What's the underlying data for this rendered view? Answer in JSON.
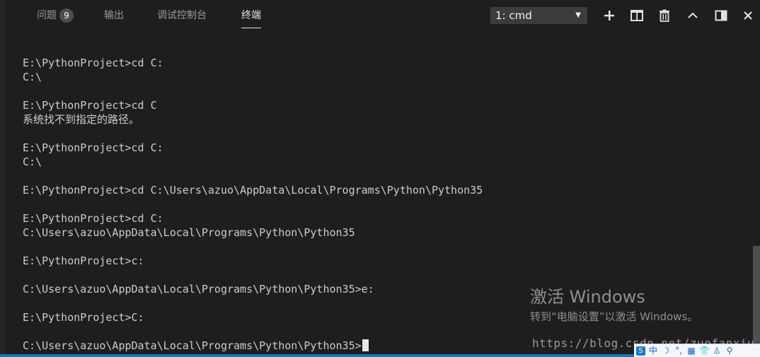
{
  "panel": {
    "tabs": [
      {
        "label": "问题",
        "badge": "9"
      },
      {
        "label": "输出"
      },
      {
        "label": "调试控制台"
      },
      {
        "label": "终端"
      }
    ],
    "terminal_selector": {
      "value": "1: cmd"
    },
    "icons": [
      "plus-icon",
      "split-icon",
      "trash-icon",
      "chevron-up-icon",
      "maximize-icon",
      "close-icon"
    ]
  },
  "terminal": {
    "lines": [
      "E:\\PythonProject>cd C:",
      "C:\\",
      "",
      "E:\\PythonProject>cd C",
      "系统找不到指定的路径。",
      "",
      "E:\\PythonProject>cd C:",
      "C:\\",
      "",
      "E:\\PythonProject>cd C:\\Users\\azuo\\AppData\\Local\\Programs\\Python\\Python35",
      "",
      "E:\\PythonProject>cd C:",
      "C:\\Users\\azuo\\AppData\\Local\\Programs\\Python\\Python35",
      "",
      "E:\\PythonProject>c:",
      "",
      "C:\\Users\\azuo\\AppData\\Local\\Programs\\Python\\Python35>e:",
      "",
      "E:\\PythonProject>C:",
      "",
      "C:\\Users\\azuo\\AppData\\Local\\Programs\\Python\\Python35>"
    ]
  },
  "watermark": {
    "activate_title": "激活 Windows",
    "activate_subtitle": "转到“电脑设置”以激活 Windows。",
    "blog_url": "https://blog.csdn.net/zuofanxiu"
  },
  "ime": {
    "logo": "S",
    "items": [
      "中",
      "☽",
      "°,",
      "▦",
      "👕",
      "♙",
      "⚲"
    ]
  },
  "colors": {
    "background": "#1e1e1e",
    "text": "#cccccc",
    "accent": "#007acc"
  }
}
